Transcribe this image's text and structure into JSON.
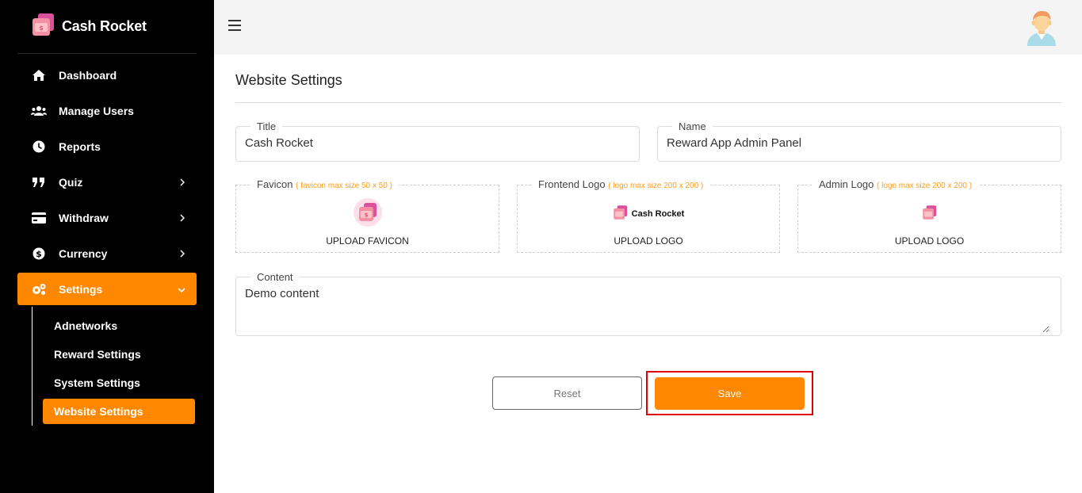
{
  "sidebar": {
    "brand": "Cash Rocket",
    "items": [
      {
        "label": "Dashboard",
        "icon": "home-icon"
      },
      {
        "label": "Manage Users",
        "icon": "users-icon"
      },
      {
        "label": "Reports",
        "icon": "clock-icon"
      },
      {
        "label": "Quiz",
        "icon": "quote-icon"
      },
      {
        "label": "Withdraw",
        "icon": "credit-card-icon"
      },
      {
        "label": "Currency",
        "icon": "dollar-icon"
      },
      {
        "label": "Settings",
        "icon": "cogs-icon"
      }
    ],
    "settings_submenu": [
      {
        "label": "Adnetworks"
      },
      {
        "label": "Reward Settings"
      },
      {
        "label": "System Settings"
      },
      {
        "label": "Website Settings"
      }
    ]
  },
  "page": {
    "title": "Website Settings"
  },
  "form": {
    "title_label": "Title",
    "title_value": "Cash Rocket",
    "name_label": "Name",
    "name_value": "Reward App Admin Panel",
    "favicon_label": "Favicon",
    "favicon_hint": "( favicon max size 50 x 50 )",
    "favicon_upload": "UPLOAD FAVICON",
    "frontend_logo_label": "Frontend Logo",
    "frontend_logo_hint": "( logo max size 200 x 200 )",
    "frontend_logo_brand": "Cash Rocket",
    "frontend_logo_upload": "UPLOAD LOGO",
    "admin_logo_label": "Admin Logo",
    "admin_logo_hint": "( logo max size 200 x 200 )",
    "admin_logo_upload": "UPLOAD LOGO",
    "content_label": "Content",
    "content_value": "Demo content",
    "reset_label": "Reset",
    "save_label": "Save"
  },
  "colors": {
    "accent": "#ff8800",
    "sidebar_bg": "#000000",
    "topbar_bg": "#f4f4f4",
    "highlight_frame": "#e00000"
  }
}
